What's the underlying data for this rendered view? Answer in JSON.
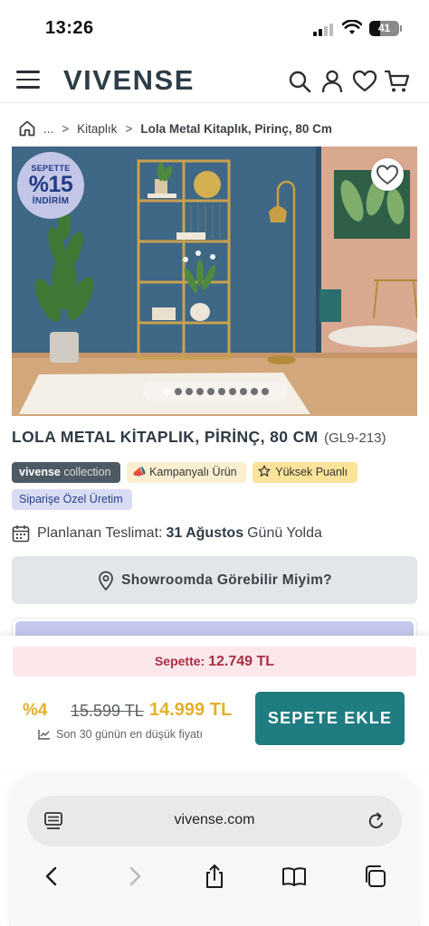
{
  "status_bar": {
    "time": "13:26",
    "battery": "41"
  },
  "header": {
    "logo": "VIVENSE",
    "icons": [
      "menu-icon",
      "search-icon",
      "user-icon",
      "heart-icon",
      "cart-icon"
    ]
  },
  "breadcrumb": {
    "ellipsis": "...",
    "category": "Kitaplık",
    "current": "Lola Metal Kitaplık, Pirinç, 80 Cm"
  },
  "product_image": {
    "badge_top": "SEPETTE",
    "badge_value": "%15",
    "badge_bottom": "İNDİRİM",
    "slide_count": 10,
    "active_slide": 1
  },
  "product": {
    "title": "LOLA METAL KİTAPLIK, PİRİNÇ, 80 CM",
    "sku": "(GL9-213)"
  },
  "tags": {
    "collection_brand": "vivense",
    "collection_word": "collection",
    "campaign": "Kampanyalı Ürün",
    "rating": "Yüksek Puanlı",
    "made_to_order": "Siparişe Özel Üretim"
  },
  "delivery": {
    "label": "Planlanan Teslimat:",
    "date": "31 Ağustos",
    "suffix": "Günü Yolda"
  },
  "showroom_button": "Showroomda Görebilir Miyim?",
  "price_bar": {
    "cart_label": "Sepette:",
    "cart_price": "12.749 TL",
    "discount": "%4",
    "old_price": "15.599 TL",
    "new_price": "14.999 TL",
    "lowest_note": "Son 30 günün en düşük fiyatı",
    "add_to_cart": "SEPETE EKLE"
  },
  "safari": {
    "url": "vivense.com",
    "toolbar_icons": [
      "back-icon",
      "forward-icon",
      "share-icon",
      "bookmarks-icon",
      "tabs-icon"
    ]
  },
  "colors": {
    "brand_dark": "#2e3d46",
    "teal_button": "#1f7c80",
    "price_gold": "#e3b02a",
    "cart_strip_bg": "#fce8ea",
    "cart_strip_text": "#a92c45",
    "badge_bg": "#c4c6e7",
    "badge_text": "#1f3b86"
  }
}
